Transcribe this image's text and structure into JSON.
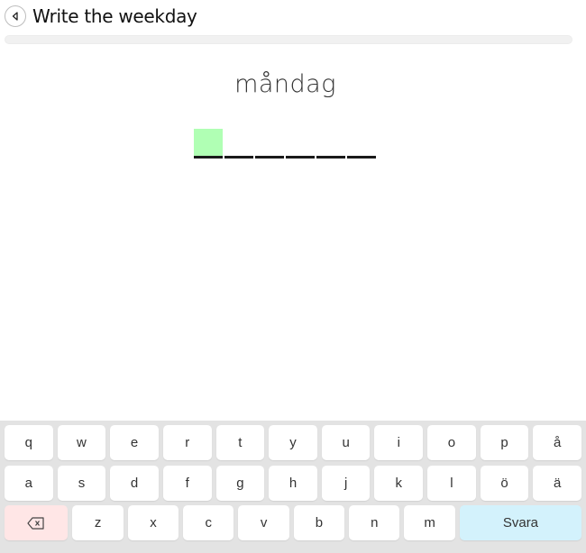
{
  "header": {
    "back_icon": "chevron-left-circle-icon",
    "title": "Write the weekday"
  },
  "progress": {
    "value_percent": 0
  },
  "prompt": {
    "word": "måndag"
  },
  "answer": {
    "slot_count": 6,
    "active_slot_index": 0,
    "letters": [
      "",
      "",
      "",
      "",
      "",
      ""
    ],
    "active_color": "#b0ffb4"
  },
  "keyboard": {
    "row1": [
      "q",
      "w",
      "e",
      "r",
      "t",
      "y",
      "u",
      "i",
      "o",
      "p",
      "å"
    ],
    "row2": [
      "a",
      "s",
      "d",
      "f",
      "g",
      "h",
      "j",
      "k",
      "l",
      "ö",
      "ä"
    ],
    "row3": [
      "z",
      "x",
      "c",
      "v",
      "b",
      "n",
      "m"
    ],
    "backspace_icon": "backspace-icon",
    "submit_label": "Svara",
    "colors": {
      "backspace_bg": "#ffe6e6",
      "submit_bg": "#d3f2fc",
      "key_bg": "#ffffff",
      "keyboard_bg": "#e3e3e3"
    }
  }
}
